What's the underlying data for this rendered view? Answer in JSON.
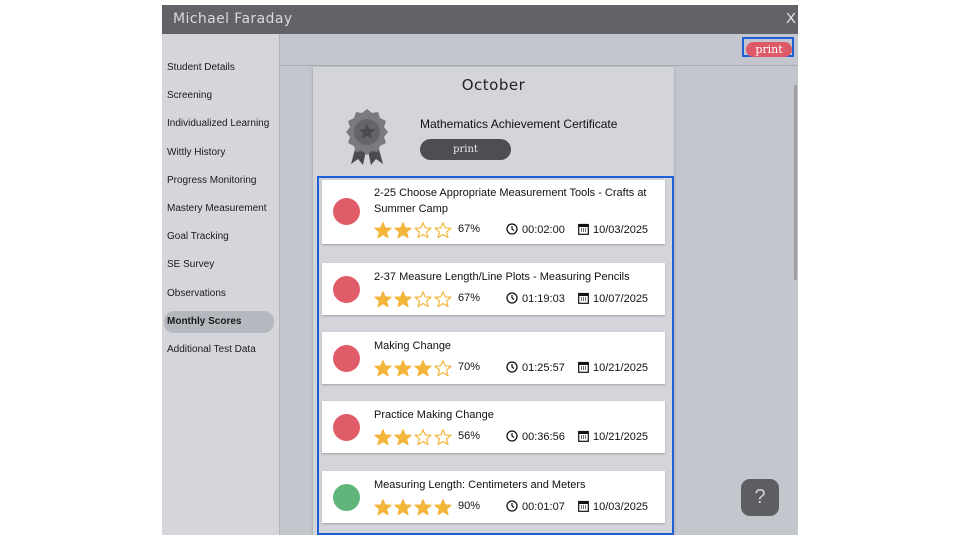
{
  "window": {
    "title": "Michael Faraday",
    "close_label": "X"
  },
  "sidebar": {
    "items": [
      {
        "label": "Student Details"
      },
      {
        "label": "Screening"
      },
      {
        "label": "Individualized Learning"
      },
      {
        "label": "Wittly History"
      },
      {
        "label": "Progress Monitoring"
      },
      {
        "label": "Mastery Measurement"
      },
      {
        "label": "Goal Tracking"
      },
      {
        "label": "SE Survey"
      },
      {
        "label": "Observations"
      },
      {
        "label": "Monthly Scores",
        "active": true
      },
      {
        "label": "Additional Test Data"
      }
    ]
  },
  "toolbar": {
    "print_label": "print"
  },
  "main": {
    "month": "October",
    "certificate": {
      "title": "Mathematics Achievement Certificate",
      "print_label": "print"
    },
    "results": [
      {
        "name": "2-25 Choose Appropriate Measurement Tools - Crafts at Summer Camp",
        "stars": 2,
        "percent": "67%",
        "time": "00:02:00",
        "date": "10/03/2025",
        "status_color": "#e05c68"
      },
      {
        "name": "2-37 Measure Length/Line Plots - Measuring Pencils",
        "stars": 2,
        "percent": "67%",
        "time": "01:19:03",
        "date": "10/07/2025",
        "status_color": "#e05c68"
      },
      {
        "name": "Making Change",
        "stars": 3,
        "percent": "70%",
        "time": "01:25:57",
        "date": "10/21/2025",
        "status_color": "#e05c68"
      },
      {
        "name": "Practice Making Change",
        "stars": 2,
        "percent": "56%",
        "time": "00:36:56",
        "date": "10/21/2025",
        "status_color": "#e05c68"
      },
      {
        "name": "Measuring Length: Centimeters and Meters",
        "stars": 4,
        "percent": "90%",
        "time": "00:01:07",
        "date": "10/03/2025",
        "status_color": "#5fb57a"
      }
    ]
  },
  "help": {
    "label": "?"
  },
  "colors": {
    "accent_frame": "#1f5fd6",
    "star": "#f3b53a",
    "fail": "#e05c68",
    "pass": "#5fb57a"
  }
}
